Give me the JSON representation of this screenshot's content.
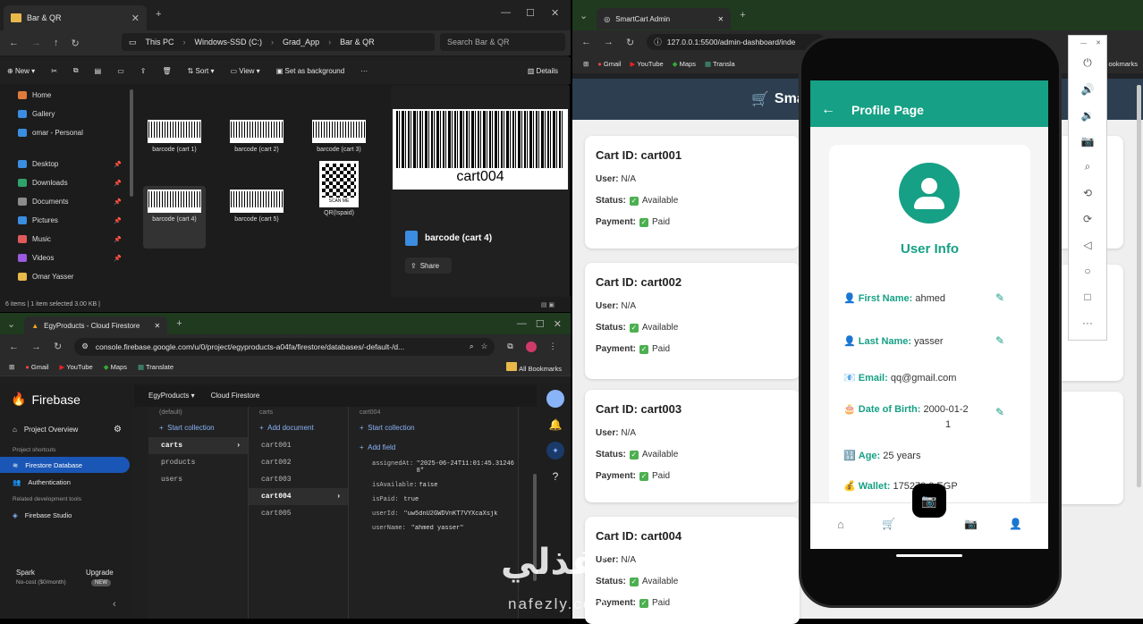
{
  "explorer": {
    "tab_title": "Bar & QR",
    "breadcrumb": [
      "This PC",
      "Windows-SSD (C:)",
      "Grad_App",
      "Bar & QR"
    ],
    "search_placeholder": "Search Bar & QR",
    "commands": {
      "new": "New",
      "sort": "Sort",
      "view": "View",
      "set_bg": "Set as background",
      "details": "Details"
    },
    "sidebar": [
      {
        "label": "Home",
        "color": "#e07a3a"
      },
      {
        "label": "Gallery",
        "color": "#3a8de0"
      },
      {
        "label": "omar - Personal",
        "color": "#3a8de0"
      },
      {
        "label": "Desktop",
        "color": "#3a8de0"
      },
      {
        "label": "Downloads",
        "color": "#2fa36b"
      },
      {
        "label": "Documents",
        "color": "#8c8c8c"
      },
      {
        "label": "Pictures",
        "color": "#3a8de0"
      },
      {
        "label": "Music",
        "color": "#e05a5a"
      },
      {
        "label": "Videos",
        "color": "#9b5ae0"
      },
      {
        "label": "Omar Yasser",
        "color": "#e8b94a"
      }
    ],
    "files": [
      {
        "label": "barcode (cart 1)",
        "code": "cart001"
      },
      {
        "label": "barcode (cart 2)",
        "code": "cart002"
      },
      {
        "label": "barcode (cart 3)",
        "code": "cart003"
      },
      {
        "label": "barcode (cart 4)",
        "code": "cart004"
      },
      {
        "label": "barcode (cart 5)",
        "code": "cart005"
      },
      {
        "label": "QR(Ispaid)",
        "code": "SCAN ME"
      }
    ],
    "preview_code": "cart004",
    "preview_name": "barcode (cart 4)",
    "share": "Share",
    "status": "6 items  |  1 item selected  3.00 KB  |"
  },
  "firebase": {
    "tab_title": "EgyProducts - Cloud Firestore",
    "url": "console.firebase.google.com/u/0/project/egyproducts-a04fa/firestore/databases/-default-/d...",
    "bookmarks": [
      "Gmail",
      "YouTube",
      "Maps",
      "Translate"
    ],
    "all_bookmarks": "All Bookmarks",
    "brand": "Firebase",
    "project": "EgyProducts",
    "section": "Cloud Firestore",
    "nav": {
      "overview": "Project Overview",
      "shortcuts": "Project shortcuts",
      "firestore": "Firestore Database",
      "auth": "Authentication",
      "related": "Related development tools",
      "studio": "Firebase Studio",
      "plan": "Spark",
      "plan_sub": "No-cost ($0/month)",
      "upgrade": "Upgrade",
      "new": "NEW"
    },
    "col1": {
      "header": "(default)",
      "add": "Start collection",
      "items": [
        "carts",
        "products",
        "users"
      ]
    },
    "col2": {
      "header": "carts",
      "add": "Add document",
      "items": [
        "cart001",
        "cart002",
        "cart003",
        "cart004",
        "cart005"
      ]
    },
    "col3": {
      "header": "cart004",
      "add1": "Start collection",
      "add2": "Add field",
      "fields": [
        {
          "k": "assignedAt:",
          "v": "\"2025-06-24T11:01:45.312468\""
        },
        {
          "k": "isAvailable:",
          "v": "false"
        },
        {
          "k": "isPaid:",
          "v": "true"
        },
        {
          "k": "userId:",
          "v": "\"uw5dnU2GWDVnKT7VYXcaXsjk"
        },
        {
          "k": "userName:",
          "v": "\"ahmed yasser\""
        }
      ]
    }
  },
  "smartcart": {
    "tab_title": "SmartCart Admin",
    "url": "127.0.0.1:5500/admin-dashboard/inde",
    "bookmarks": [
      "Gmail",
      "YouTube",
      "Maps",
      "Transla"
    ],
    "bookmarks_right": "ookmarks",
    "header": "Sma",
    "carts": [
      {
        "id": "Cart ID: cart001",
        "user": "N/A",
        "status": "Available",
        "payment": "Paid"
      },
      {
        "id": "Cart ID: cart002",
        "user": "N/A",
        "status": "Available",
        "payment": "Paid"
      },
      {
        "id": "Cart ID: cart003",
        "user": "N/A",
        "status": "Available",
        "payment": "Paid"
      },
      {
        "id": "Cart ID: cart004",
        "user": "N/A",
        "status": "Available",
        "payment": "Paid"
      }
    ],
    "labels": {
      "user": "User:",
      "status": "Status:",
      "payment": "Payment:"
    }
  },
  "phone": {
    "title": "Profile Page",
    "user_info": "User Info",
    "fields": [
      {
        "k": "First Name:",
        "v": "ahmed",
        "icon": "👤"
      },
      {
        "k": "Last Name:",
        "v": "yasser",
        "icon": "👤"
      },
      {
        "k": "Email:",
        "v": "qq@gmail.com",
        "icon": "📧"
      },
      {
        "k": "Date of Birth:",
        "v": "2000-01-2",
        "v2": "1",
        "icon": "🎂"
      },
      {
        "k": "Age:",
        "v": "25 years",
        "icon": "🔢"
      },
      {
        "k": "Wallet:",
        "v": "175270.0 EGP",
        "icon": "💰"
      }
    ]
  },
  "watermark": {
    "ar": "نفذلي",
    "en": "nafezly.com"
  },
  "colors": {
    "teal": "#16a085",
    "header": "#2c3e50",
    "firebase_blue": "#1a56b5"
  }
}
